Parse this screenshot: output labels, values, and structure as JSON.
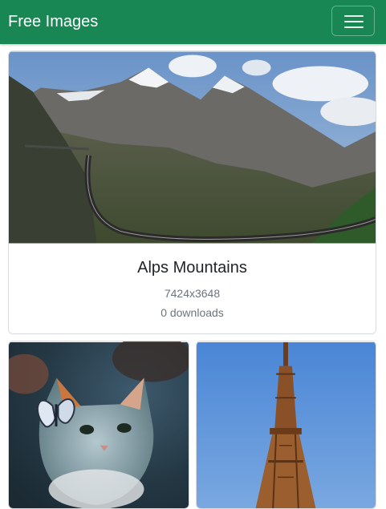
{
  "navbar": {
    "brand": "Free Images",
    "toggle_icon": "menu-icon",
    "bg_color": "#198754"
  },
  "featured": {
    "title": "Alps Mountains",
    "dimensions": "7424x3648",
    "downloads": "0 downloads"
  },
  "gallery": [
    {
      "subject": "cat-with-butterfly"
    },
    {
      "subject": "eiffel-tower"
    }
  ]
}
